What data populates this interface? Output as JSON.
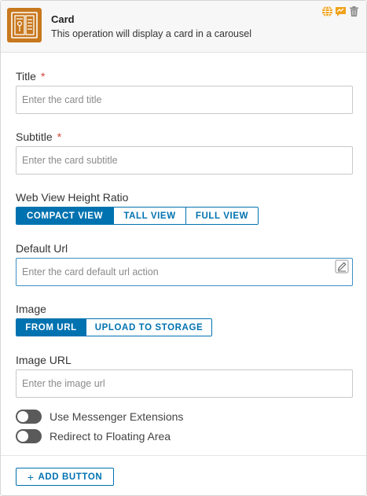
{
  "header": {
    "title": "Card",
    "description": "This operation will display a card in a carousel",
    "icon": "card-carousel-icon",
    "accent": "#c8781e",
    "actions": [
      "globe-icon",
      "chat-icon",
      "trash-icon"
    ]
  },
  "fields": {
    "title": {
      "label": "Title",
      "required_mark": "*",
      "placeholder": "Enter the card title",
      "value": ""
    },
    "subtitle": {
      "label": "Subtitle",
      "required_mark": "*",
      "placeholder": "Enter the card subtitle",
      "value": ""
    },
    "web_view": {
      "label": "Web View Height Ratio",
      "options": [
        "COMPACT VIEW",
        "TALL VIEW",
        "FULL VIEW"
      ],
      "selected": "COMPACT VIEW"
    },
    "default_url": {
      "label": "Default Url",
      "placeholder": "Enter the card default url action",
      "value": ""
    },
    "image": {
      "label": "Image",
      "options": [
        "FROM URL",
        "UPLOAD TO STORAGE"
      ],
      "selected": "FROM URL"
    },
    "image_url": {
      "label": "Image URL",
      "placeholder": "Enter the image url",
      "value": ""
    }
  },
  "toggles": [
    {
      "label": "Use Messenger Extensions",
      "on": false
    },
    {
      "label": "Redirect to Floating Area",
      "on": false
    }
  ],
  "footer": {
    "add_button_label": "ADD BUTTON",
    "add_icon": "+"
  },
  "colors": {
    "primary": "#0072b0",
    "required": "#d0453a",
    "toggle_off": "#5a5a5a"
  }
}
